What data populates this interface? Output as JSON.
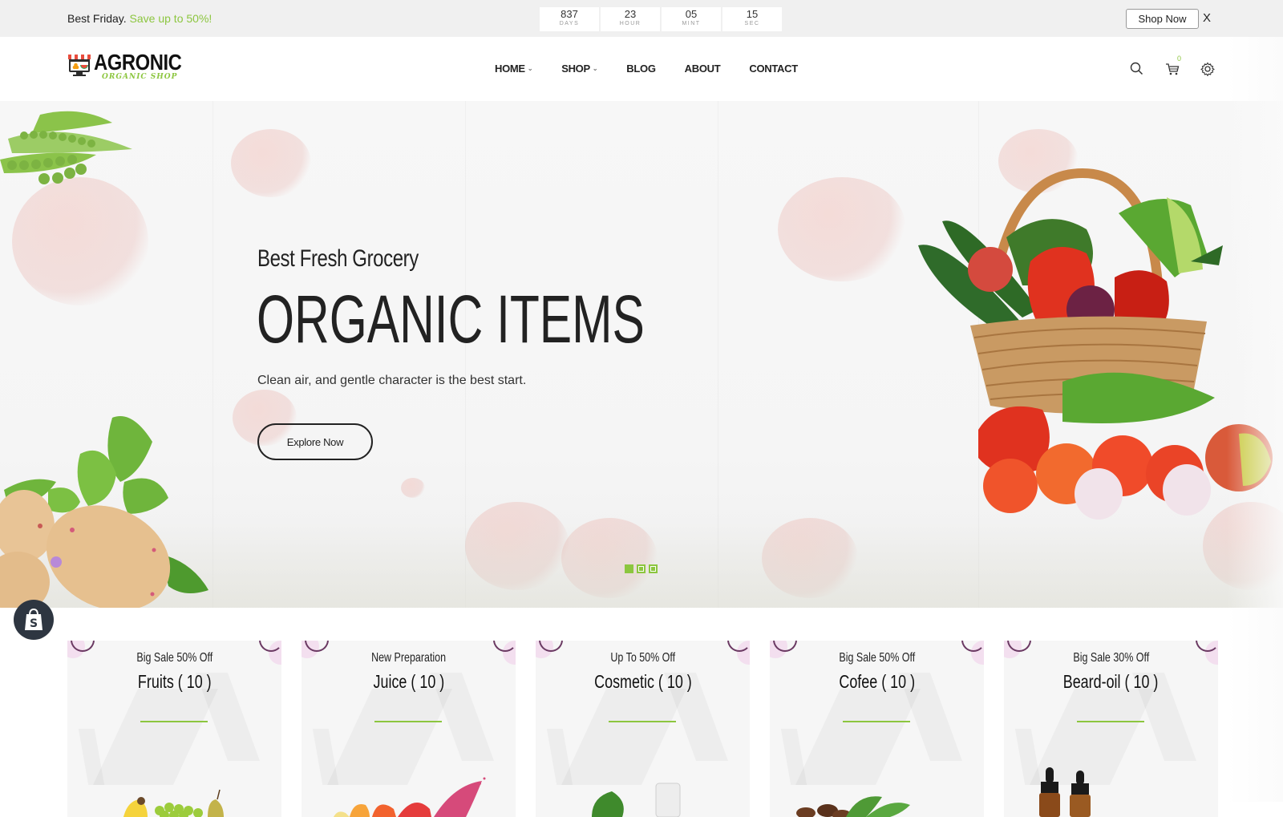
{
  "topbar": {
    "promo_text": "Best Friday.",
    "promo_accent": "Save up to 50%!",
    "countdown": [
      {
        "value": "837",
        "label": "DAYS"
      },
      {
        "value": "23",
        "label": "HOUR"
      },
      {
        "value": "05",
        "label": "MINT"
      },
      {
        "value": "15",
        "label": "SEC"
      }
    ],
    "shop_now_label": "Shop Now",
    "close_label": "X"
  },
  "header": {
    "logo_name": "AGRONIC",
    "logo_tagline": "ORGANIC SHOP",
    "nav": [
      {
        "label": "HOME",
        "has_dropdown": true
      },
      {
        "label": "SHOP",
        "has_dropdown": true
      },
      {
        "label": "BLOG",
        "has_dropdown": false
      },
      {
        "label": "ABOUT",
        "has_dropdown": false
      },
      {
        "label": "CONTACT",
        "has_dropdown": false
      }
    ],
    "icons": [
      "search-icon",
      "cart-icon",
      "gear-icon"
    ],
    "cart_count": "0"
  },
  "hero": {
    "subtitle": "Best Fresh Grocery",
    "title": "ORGANIC ITEMS",
    "description": "Clean air, and gentle character is the best start.",
    "cta_label": "Explore Now",
    "slide_count": 3,
    "active_slide": 1
  },
  "categories": [
    {
      "tag": "Big Sale 50% Off",
      "title": "Fruits ( 10 )",
      "image": "fruits"
    },
    {
      "tag": "New Preparation",
      "title": "Juice ( 10 )",
      "image": "juice"
    },
    {
      "tag": "Up To 50% Off",
      "title": "Cosmetic ( 10 )",
      "image": "cosmetic"
    },
    {
      "tag": "Big Sale 50% Off",
      "title": "Cofee ( 10 )",
      "image": "coffee"
    },
    {
      "tag": "Big Sale 30% Off",
      "title": "Beard-oil ( 10 )",
      "image": "beard-oil"
    }
  ],
  "colors": {
    "accent": "#8cc63f",
    "text": "#222222",
    "topbar_bg": "#f0f0f0",
    "badge_bg": "#2e3641"
  }
}
